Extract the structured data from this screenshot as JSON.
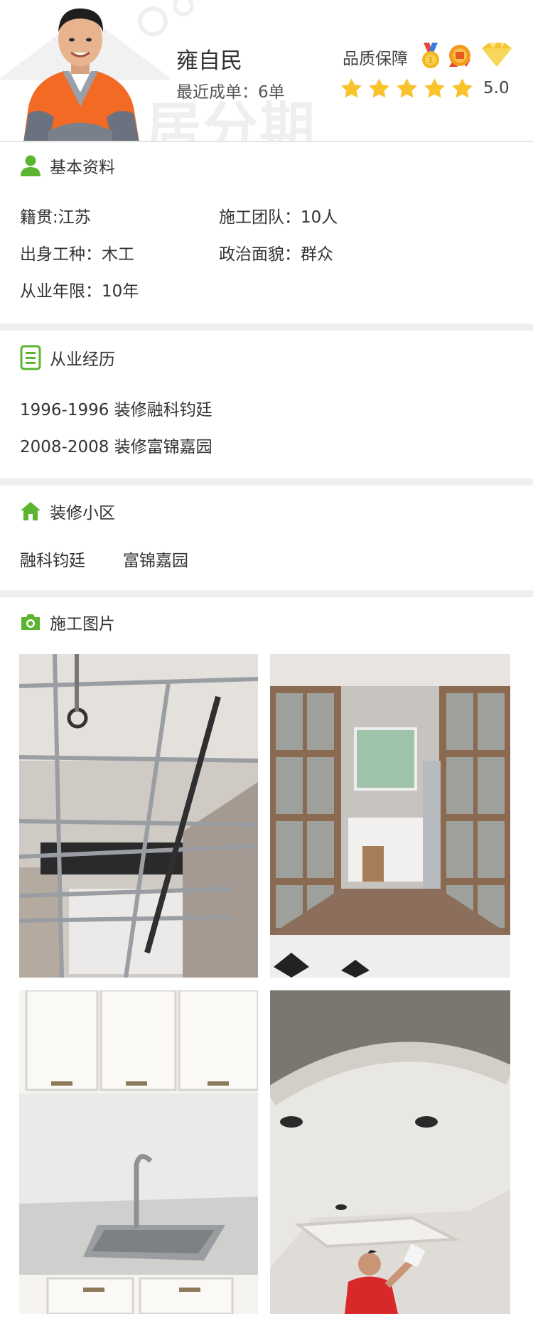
{
  "header": {
    "watermark_text": "居分期",
    "name": "雍自民",
    "recent_orders": "最近成单：6单",
    "quality_label": "品质保障",
    "badges": [
      "medal-icon",
      "seal-badge-icon",
      "diamond-icon"
    ],
    "rating_stars": 5,
    "rating_score": "5.0"
  },
  "basic_info": {
    "title": "基本资料",
    "icon": "person-icon",
    "native_place": "籍贯:江苏",
    "team": "施工团队：10人",
    "trade": "出身工种：木工",
    "politics": "政治面貌：群众",
    "years": "从业年限：10年"
  },
  "experience": {
    "title": "从业经历",
    "icon": "document-icon",
    "items": [
      "1996-1996 装修融科钧廷",
      "2008-2008 装修富锦嘉园"
    ]
  },
  "communities": {
    "title": "装修小区",
    "icon": "home-icon",
    "items": [
      "融科钧廷",
      "富锦嘉园"
    ]
  },
  "photos": {
    "title": "施工图片",
    "icon": "camera-icon",
    "items": [
      "ceiling-frame-photo",
      "sliding-door-kitchen-photo",
      "kitchen-sink-photo",
      "ceiling-painting-photo"
    ]
  },
  "colors": {
    "accent_green": "#5cb531",
    "star_yellow": "#f9c32c",
    "divider_gray": "#efefef"
  }
}
